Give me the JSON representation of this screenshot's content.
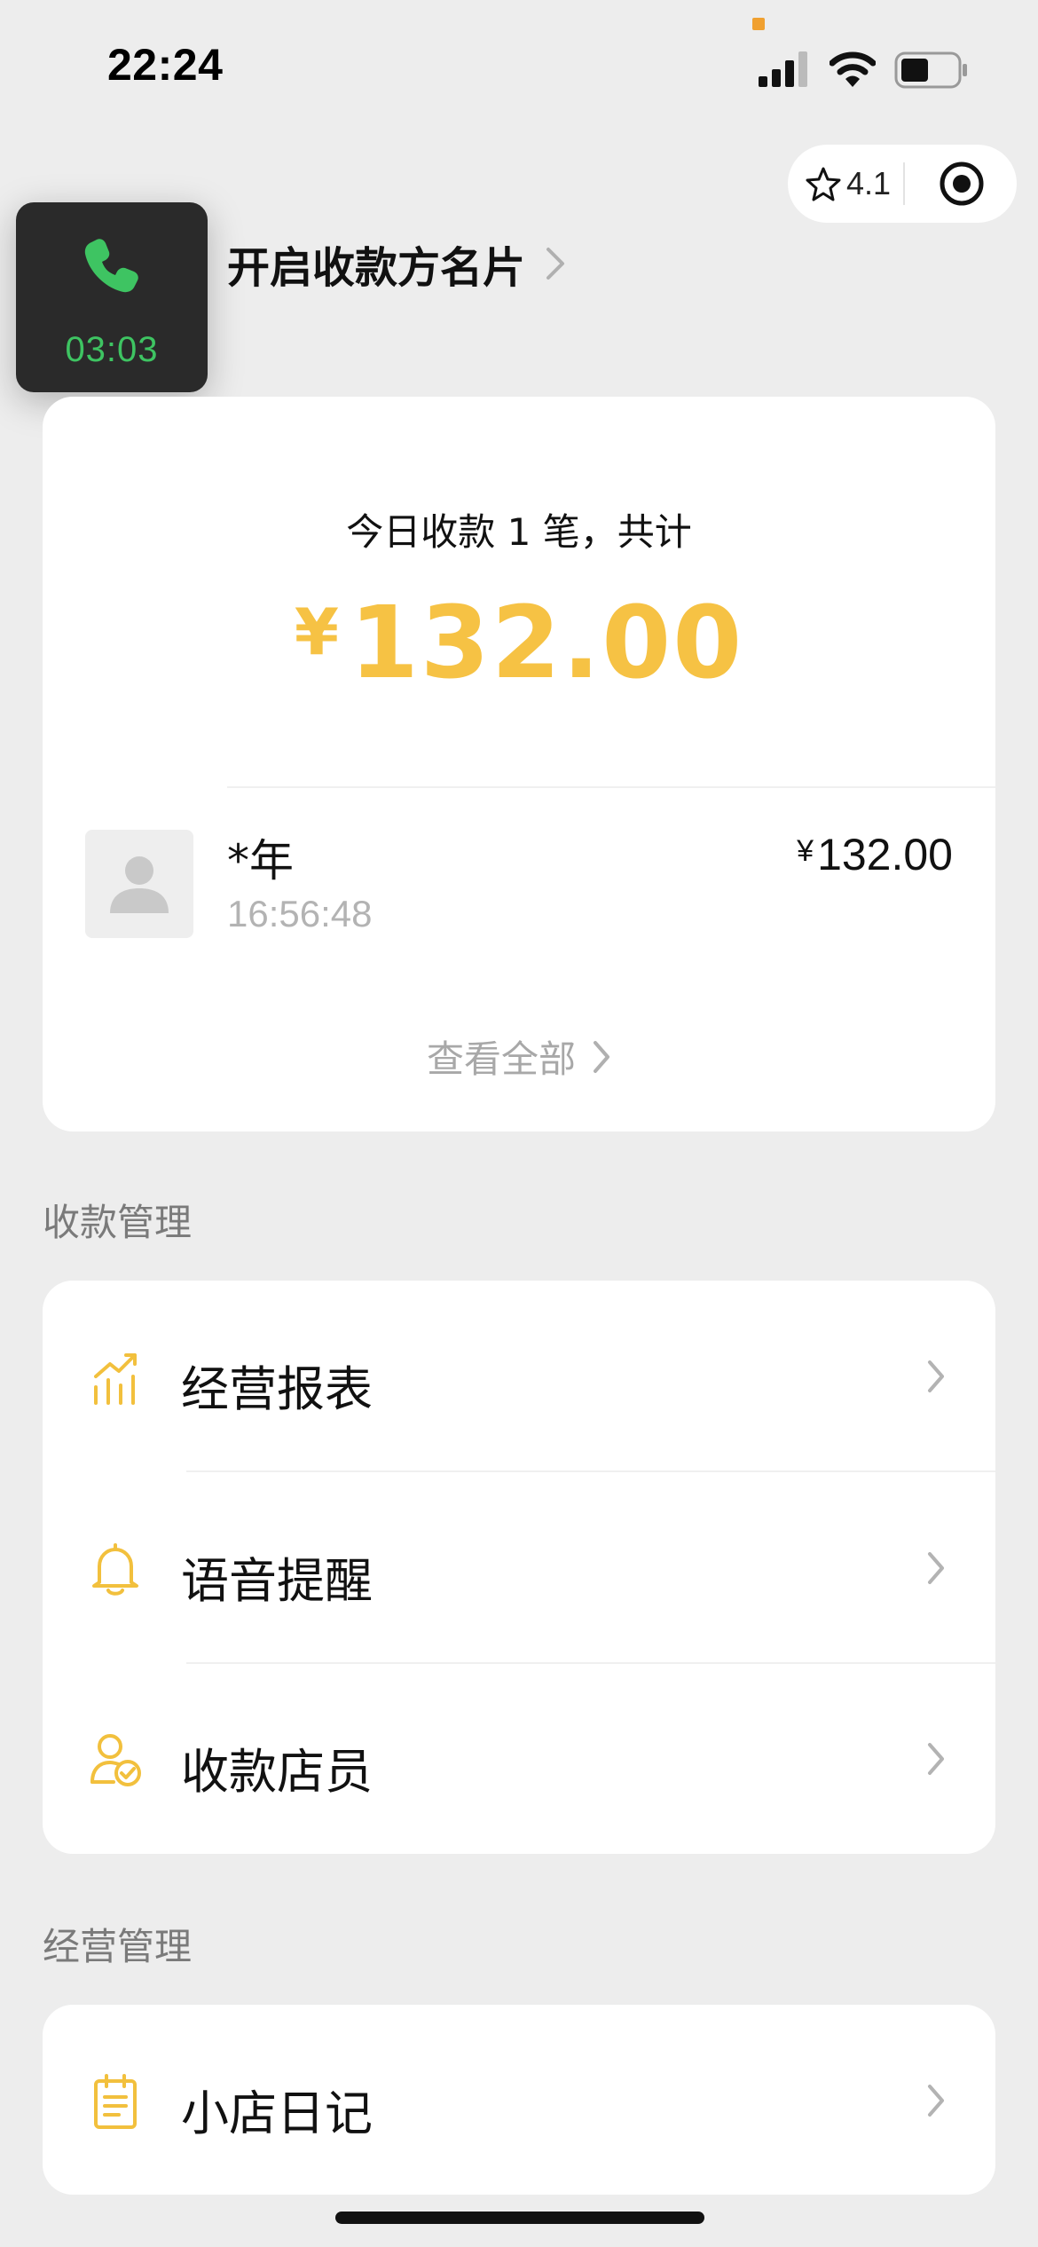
{
  "status_bar": {
    "time": "22:24"
  },
  "capsule": {
    "rating": "4.1",
    "star_icon": "star-outline-icon",
    "record_icon": "target-record-icon"
  },
  "header": {
    "notice_text": "息，开启收款方名片"
  },
  "call_widget": {
    "timer": "03:03",
    "icon": "phone-icon",
    "color": "#3ec462"
  },
  "summary": {
    "today_text": "今日收款 1 笔，共计",
    "currency": "¥",
    "total": "132.00",
    "accent_color": "#f6c244"
  },
  "transactions": [
    {
      "name": "*年",
      "time": "16:56:48",
      "currency": "¥",
      "amount": "132.00"
    }
  ],
  "view_all_label": "查看全部",
  "sections": [
    {
      "title": "收款管理",
      "items": [
        {
          "label": "经营报表",
          "icon": "report-chart-icon"
        },
        {
          "label": "语音提醒",
          "icon": "bell-icon"
        },
        {
          "label": "收款店员",
          "icon": "staff-check-icon"
        }
      ]
    },
    {
      "title": "经营管理",
      "items": [
        {
          "label": "小店日记",
          "icon": "notepad-icon"
        }
      ]
    }
  ]
}
